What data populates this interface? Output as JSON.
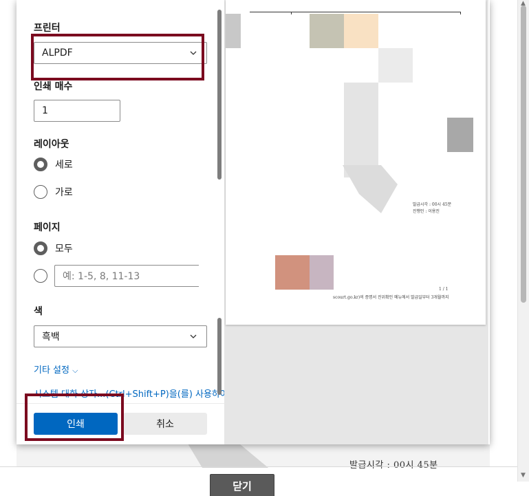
{
  "colors": {
    "accent": "#0067c0",
    "highlight": "#7b0a1f",
    "close_button_bg": "#5a5a5a"
  },
  "print_dialog": {
    "printer": {
      "label": "프린터",
      "selected": "ALPDF",
      "icon": "chevron-down-icon"
    },
    "copies": {
      "label": "인쇄 매수",
      "value": "1"
    },
    "layout": {
      "label": "레이아웃",
      "options": [
        {
          "label": "세로",
          "checked": true
        },
        {
          "label": "가로",
          "checked": false
        }
      ]
    },
    "pages": {
      "label": "페이지",
      "all_label": "모두",
      "all_checked": true,
      "custom_placeholder": "예: 1-5, 8, 11-13"
    },
    "color": {
      "label": "색",
      "selected": "흑백",
      "icon": "chevron-down-icon"
    },
    "more_settings": "기타 설정",
    "system_dialog": "시스템 대화 상자...(Ctrl+Shift+P)을(를) 사용하여",
    "print_button": "인쇄",
    "cancel_button": "취소"
  },
  "preview": {
    "issue_time": "발급시각 : 00시 45분",
    "issuer": "진행인 : 이용진",
    "page_number": "1 / 1",
    "footer_note": "scourt.go.kr)의 증명서 진위확인 메뉴에서 발급일부터 3개월까지"
  },
  "background": {
    "issue_time": "발급시각 : 00시 45분",
    "close_button": "닫기"
  }
}
